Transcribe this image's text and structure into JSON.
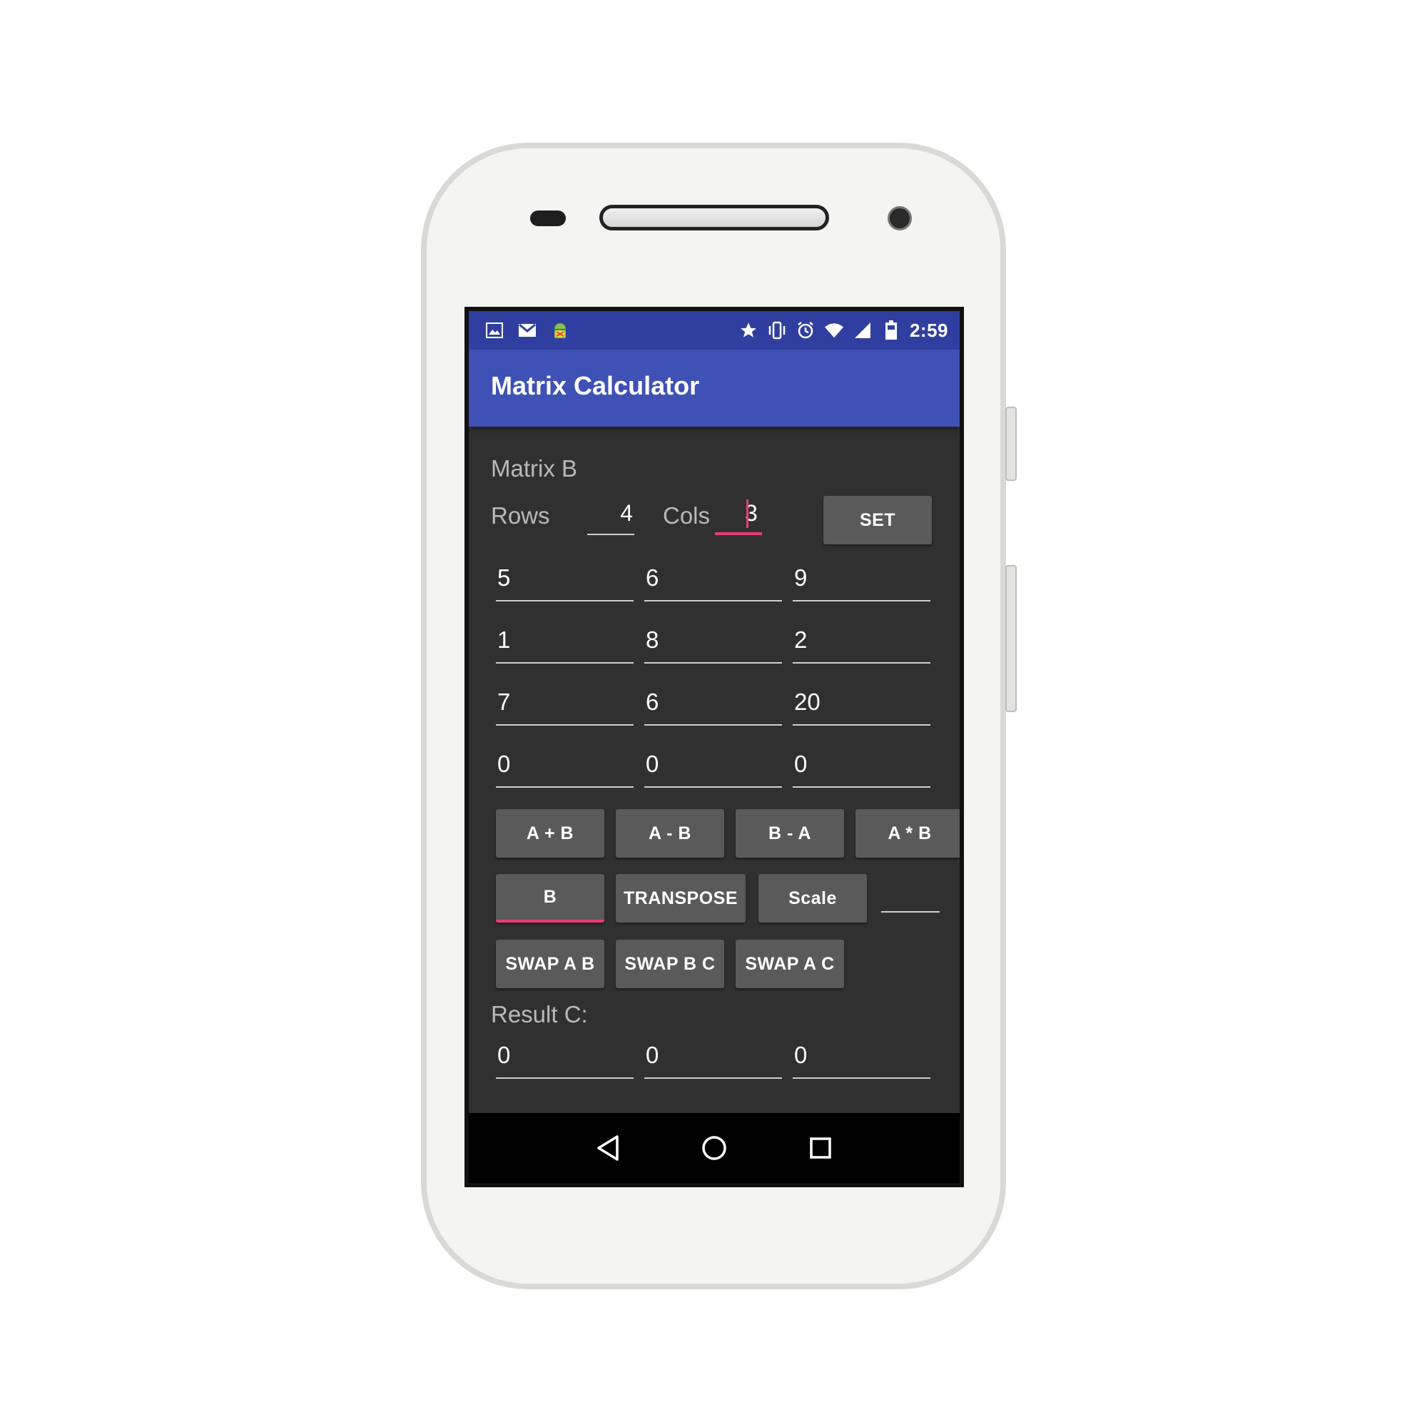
{
  "status_bar": {
    "left_icons": [
      "image-icon",
      "gmail-icon",
      "android-debug-icon"
    ],
    "right_icons": [
      "star-icon",
      "vibrate-icon",
      "alarm-icon",
      "wifi-icon",
      "signal-icon",
      "battery-icon"
    ],
    "time": "2:59"
  },
  "app_bar": {
    "title": "Matrix Calculator"
  },
  "matrix": {
    "heading": "Matrix B",
    "rows_label": "Rows",
    "rows_value": "4",
    "cols_label": "Cols",
    "cols_value": "3",
    "set_button": "SET",
    "cells": [
      [
        "5",
        "6",
        "9"
      ],
      [
        "1",
        "8",
        "2"
      ],
      [
        "7",
        "6",
        "20"
      ],
      [
        "0",
        "0",
        "0"
      ]
    ]
  },
  "operations": {
    "row1": [
      "A + B",
      "A - B",
      "B - A",
      "A * B"
    ],
    "row2": [
      "B",
      "TRANSPOSE",
      "Scale"
    ],
    "scale_input_value": "",
    "row3": [
      "SWAP A B",
      "SWAP B C",
      "SWAP A C"
    ]
  },
  "result": {
    "heading": "Result C:",
    "cells": [
      "0",
      "0",
      "0"
    ]
  },
  "nav_bar": {
    "icons": [
      "back-icon",
      "home-icon",
      "recents-icon"
    ]
  },
  "colors": {
    "status_bar": "#303f9f",
    "app_bar": "#3f51b5",
    "background": "#303030",
    "button": "#5a5a5a",
    "accent": "#e53d77"
  }
}
